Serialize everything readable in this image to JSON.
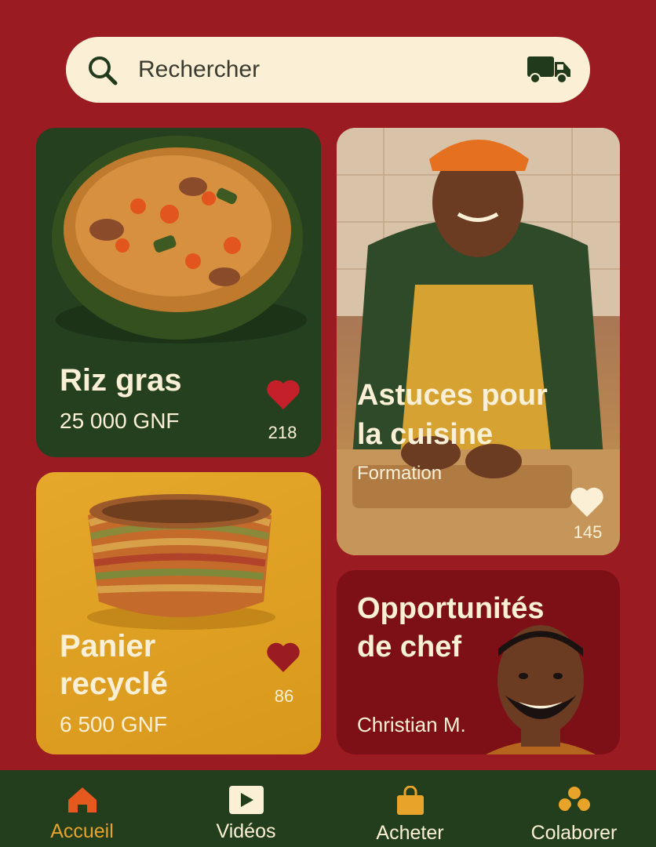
{
  "search": {
    "placeholder": "Rechercher",
    "search_icon": "search-icon",
    "truck_icon": "truck-icon"
  },
  "cards": [
    {
      "title": "Riz gras",
      "price": "25 000 GNF",
      "likes": "218"
    },
    {
      "title_line1": "Astuces pour",
      "title_line2": "la cuisine",
      "subtitle": "Formation",
      "likes": "145"
    },
    {
      "title_line1": "Panier",
      "title_line2": "recyclé",
      "price": "6 500 GNF",
      "likes": "86"
    },
    {
      "title_line1": "Opportunités",
      "title_line2": "de chef",
      "name": "Christian M."
    }
  ],
  "nav": [
    {
      "label": "Accueil",
      "icon": "home-icon",
      "active": true
    },
    {
      "label": "Vidéos",
      "icon": "video-icon"
    },
    {
      "label": "Acheter",
      "icon": "shopping-bag-icon"
    },
    {
      "label": "Colaborer",
      "icon": "collaborate-icon"
    }
  ],
  "colors": {
    "background": "#9a1b22",
    "cream": "#fbf0d6",
    "green": "#24401e",
    "accent": "#e8a32a"
  }
}
